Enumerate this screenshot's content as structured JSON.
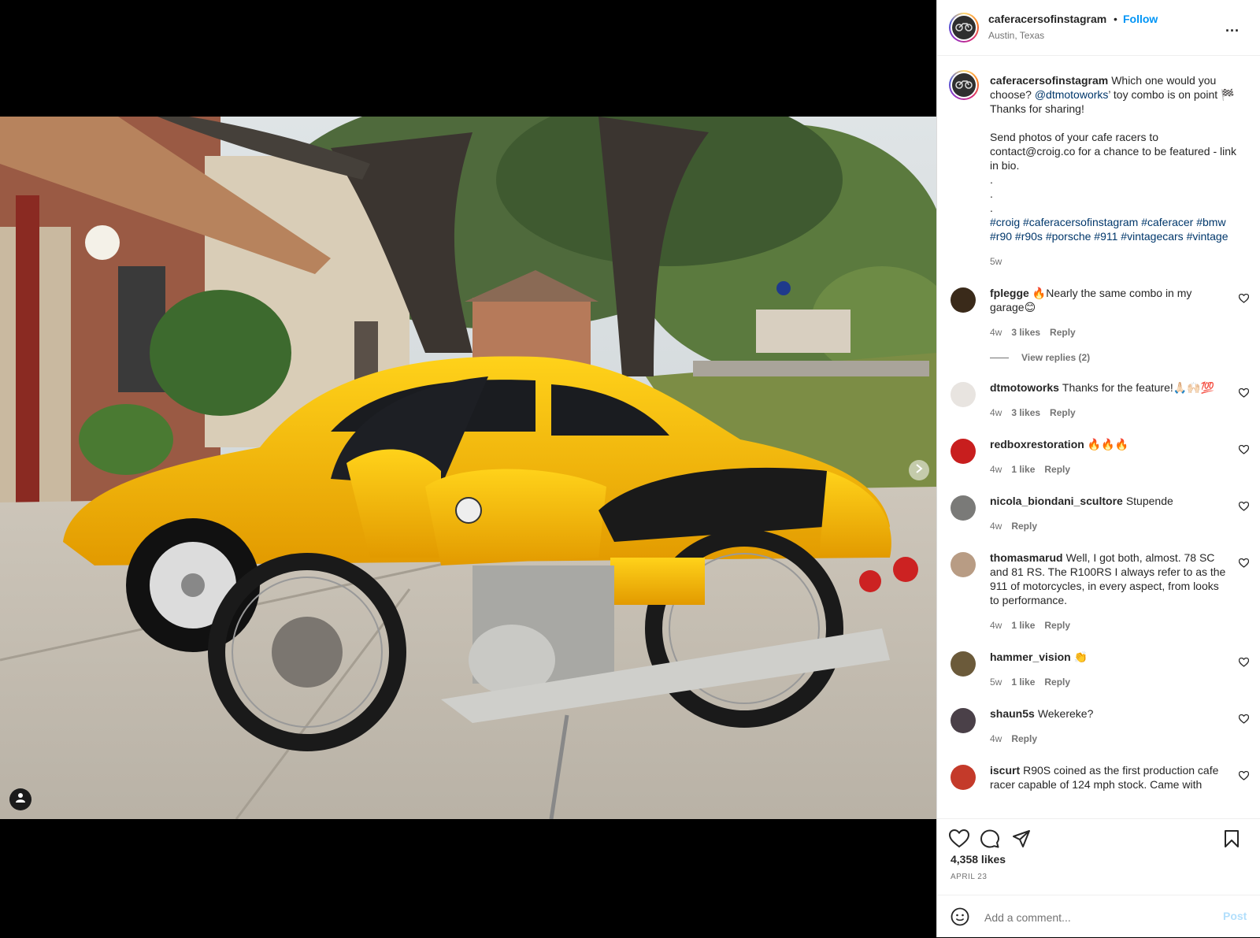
{
  "post": {
    "username": "caferacersofinstagram",
    "separator": "•",
    "follow_label": "Follow",
    "location": "Austin, Texas",
    "more_label": "...",
    "caption": {
      "username": "caferacersofinstagram",
      "text_before_mention": "Which one would you choose? ",
      "mention": "@dtmotoworks",
      "text_after_mention": "’ toy combo is on point 🏁\nThanks for sharing!\n\nSend photos of your cafe racers to contact@croig.co for a chance to be featured - link in bio.\n.\n.\n.\n",
      "hashtags": "#croig #caferacersofinstagram #caferacer #bmw #r90 #r90s #porsche #911 #vintagecars #vintage",
      "time": "5w"
    },
    "likes": "4,358 likes",
    "date": "APRIL 23"
  },
  "comments": [
    {
      "user": "fplegge",
      "text": "🔥Nearly the same combo in my garage😊",
      "time": "4w",
      "likes": "3 likes",
      "reply": "Reply",
      "avatar_color": "#3a2a1a"
    },
    {
      "user": "dtmotoworks",
      "text": "Thanks for the feature!🙏🏻🙌🏻💯",
      "time": "4w",
      "likes": "3 likes",
      "reply": "Reply",
      "avatar_color": "#e8e4e0"
    },
    {
      "user": "redboxrestoration",
      "text": "🔥🔥🔥",
      "time": "4w",
      "likes": "1 like",
      "reply": "Reply",
      "avatar_color": "#c81e1e"
    },
    {
      "user": "nicola_biondani_scultore",
      "text": "Stupende",
      "time": "4w",
      "likes": "",
      "reply": "Reply",
      "avatar_color": "#7a7a78"
    },
    {
      "user": "thomasmarud",
      "text": "Well, I got both, almost. 78 SC and 81 RS. The R100RS I always refer to as the 911 of motorcycles, in every aspect, from looks to performance.",
      "time": "4w",
      "likes": "1 like",
      "reply": "Reply",
      "avatar_color": "#b89c84"
    },
    {
      "user": "hammer_vision",
      "text": "👏",
      "time": "5w",
      "likes": "1 like",
      "reply": "Reply",
      "avatar_color": "#6b5a3a"
    },
    {
      "user": "shaun5s",
      "text": "Wekereke?",
      "time": "4w",
      "likes": "",
      "reply": "Reply",
      "avatar_color": "#4a4048"
    },
    {
      "user": "iscurt",
      "text": "R90S coined as the first production cafe racer capable of 124 mph stock. Came with",
      "time": "",
      "likes": "",
      "reply": "",
      "avatar_color": "#c43a2a"
    }
  ],
  "view_replies": "View replies (2)",
  "add_comment": {
    "placeholder": "Add a comment...",
    "post_label": "Post"
  },
  "colors": {
    "accent": "#0095f6",
    "link": "#00376b",
    "muted": "#737373",
    "post_disabled": "#b2dffc"
  },
  "icons": [
    "heart-icon",
    "comment-icon",
    "share-icon",
    "bookmark-icon",
    "emoji-icon",
    "chevron-right-icon",
    "user-tag-icon",
    "more-icon"
  ]
}
